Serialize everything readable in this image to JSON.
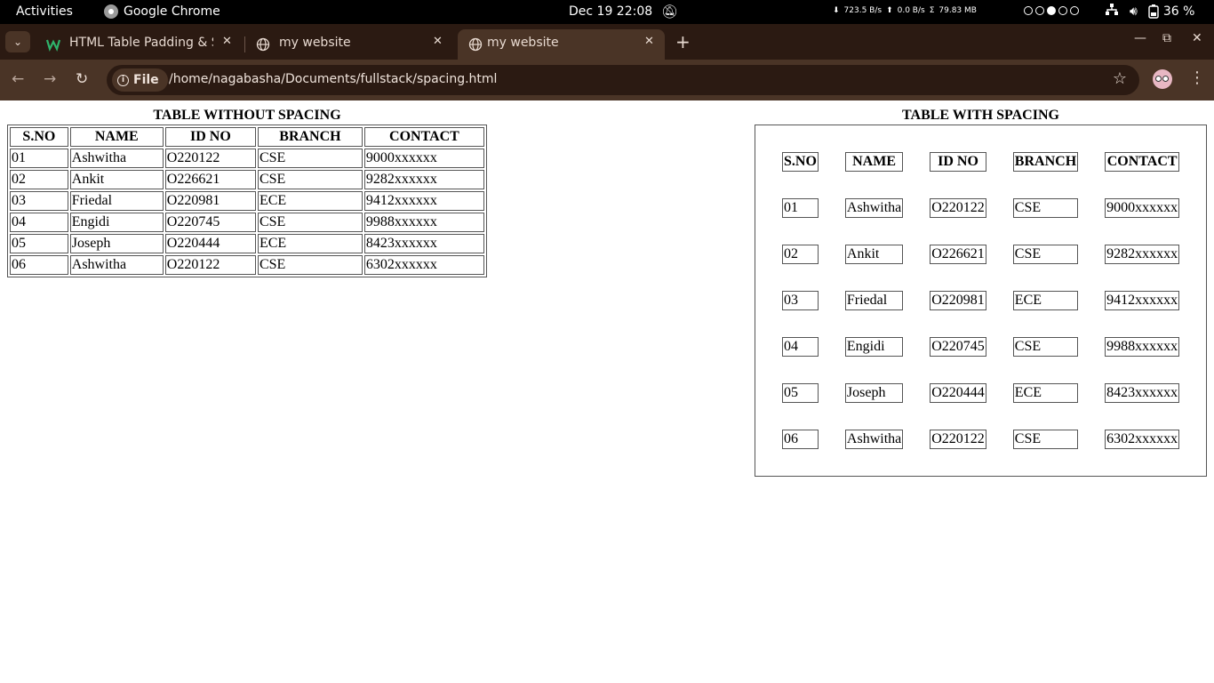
{
  "topbar": {
    "activities": "Activities",
    "app_name": "Google Chrome",
    "clock": "Dec 19  22:08",
    "net_down": "723.5 B/s",
    "net_up": "0.0 B/s",
    "mem": "79.83 MB",
    "battery": "36 %",
    "workspaces": [
      false,
      false,
      true,
      false,
      false
    ]
  },
  "tabs": [
    {
      "title": "HTML Table Padding & Sp",
      "favicon": "w3schools-icon",
      "active": false
    },
    {
      "title": "my website",
      "favicon": "globe-icon",
      "active": false
    },
    {
      "title": "my website",
      "favicon": "globe-icon",
      "active": true
    }
  ],
  "toolbar": {
    "scheme_chip": "File",
    "url": "/home/nagabasha/Documents/fullstack/spacing.html"
  },
  "page": {
    "table1": {
      "caption": "TABLE WITHOUT SPACING",
      "headers": [
        "S.NO",
        "NAME",
        "ID NO",
        "BRANCH",
        "CONTACT"
      ],
      "rows": [
        [
          "01",
          "Ashwitha",
          "O220122",
          "CSE",
          "9000xxxxxx"
        ],
        [
          "02",
          "Ankit",
          "O226621",
          "CSE",
          "9282xxxxxx"
        ],
        [
          "03",
          "Friedal",
          "O220981",
          "ECE",
          "9412xxxxxx"
        ],
        [
          "04",
          "Engidi",
          "O220745",
          "CSE",
          "9988xxxxxx"
        ],
        [
          "05",
          "Joseph",
          "O220444",
          "ECE",
          "8423xxxxxx"
        ],
        [
          "06",
          "Ashwitha",
          "O220122",
          "CSE",
          "6302xxxxxx"
        ]
      ]
    },
    "table2": {
      "caption": "TABLE WITH SPACING",
      "headers": [
        "S.NO",
        "NAME",
        "ID NO",
        "BRANCH",
        "CONTACT"
      ],
      "rows": [
        [
          "01",
          "Ashwitha",
          "O220122",
          "CSE",
          "9000xxxxxx"
        ],
        [
          "02",
          "Ankit",
          "O226621",
          "CSE",
          "9282xxxxxx"
        ],
        [
          "03",
          "Friedal",
          "O220981",
          "ECE",
          "9412xxxxxx"
        ],
        [
          "04",
          "Engidi",
          "O220745",
          "CSE",
          "9988xxxxxx"
        ],
        [
          "05",
          "Joseph",
          "O220444",
          "ECE",
          "8423xxxxxx"
        ],
        [
          "06",
          "Ashwitha",
          "O220122",
          "CSE",
          "6302xxxxxx"
        ]
      ]
    }
  },
  "colors": {
    "tabstrip_bg": "#2b1a12",
    "toolbar_bg": "#4a3426",
    "topbar_bg": "#000000"
  }
}
